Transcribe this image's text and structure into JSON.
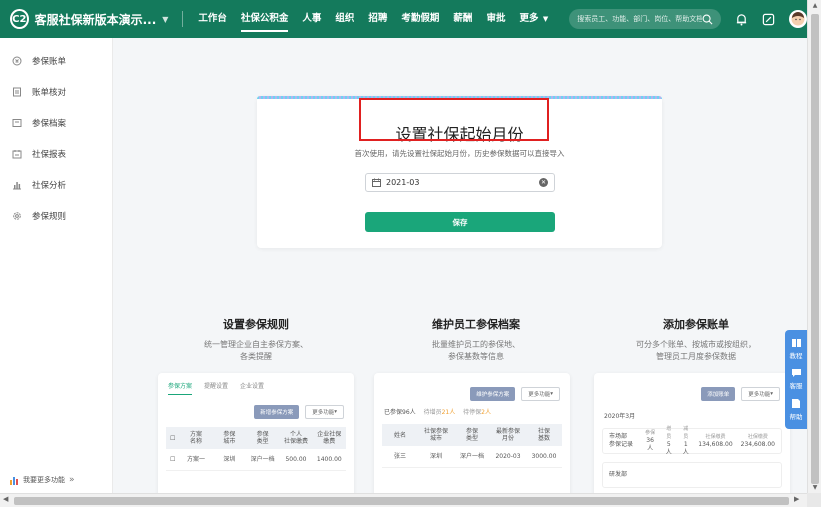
{
  "header": {
    "logo_text": "C2",
    "company_name": "客服社保新版本演示...",
    "nav": [
      {
        "label": "工作台",
        "active": false
      },
      {
        "label": "社保公积金",
        "active": true
      },
      {
        "label": "人事",
        "active": false
      },
      {
        "label": "组织",
        "active": false
      },
      {
        "label": "招聘",
        "active": false
      },
      {
        "label": "考勤假期",
        "active": false
      },
      {
        "label": "薪酬",
        "active": false
      },
      {
        "label": "审批",
        "active": false
      },
      {
        "label": "更多",
        "active": false
      }
    ],
    "search_placeholder": "搜索员工、功能、部门、岗位、帮助文档"
  },
  "sidebar": {
    "items": [
      {
        "label": "参保账单",
        "icon": "bill-icon"
      },
      {
        "label": "账单核对",
        "icon": "check-doc-icon"
      },
      {
        "label": "参保档案",
        "icon": "archive-icon"
      },
      {
        "label": "社保报表",
        "icon": "report-icon"
      },
      {
        "label": "社保分析",
        "icon": "bar-chart-icon"
      },
      {
        "label": "参保规则",
        "icon": "gear-icon"
      }
    ],
    "footer": "我要更多功能"
  },
  "setup_card": {
    "title": "设置社保起始月份",
    "subtitle": "首次使用，请先设置社保起始月份，历史参保数据可以直接导入",
    "date_value": "2021-03",
    "save_label": "保存"
  },
  "features": [
    {
      "title": "设置参保规则",
      "desc1": "统一管理企业自主参保方案、",
      "desc2": "各类提醒"
    },
    {
      "title": "维护员工参保档案",
      "desc1": "批量维护员工的参保地、",
      "desc2": "参保基数等信息"
    },
    {
      "title": "添加参保账单",
      "desc1": "可分多个账单、按城市或按组织，",
      "desc2": "管理员工月度参保数据"
    }
  ],
  "preview_rules": {
    "tabs": [
      "参保方案",
      "提醒设置",
      "企业设置"
    ],
    "btn_primary": "新增参保方案",
    "btn_more": "更多功能",
    "headers": [
      "方案\n名称",
      "参保\n城市",
      "参保\n类型",
      "个人\n社保缴费",
      "企业社保\n缴费"
    ],
    "row": [
      "方案一",
      "深圳",
      "深户一档",
      "500.00",
      "1400.00"
    ]
  },
  "preview_archive": {
    "btn_primary": "维护参保方案",
    "btn_more": "更多功能",
    "stats_main": "已参保96人",
    "stats_pending_label": "待增员",
    "stats_pending_value": "21人",
    "stats_reduce_label": "待停保",
    "stats_reduce_value": "2人",
    "headers": [
      "姓名",
      "社保参保\n城市",
      "参保\n类型",
      "最新参保\n月份",
      "社保\n基数"
    ],
    "row": [
      "张三",
      "深圳",
      "深户一档",
      "2020-03",
      "3000.00"
    ]
  },
  "preview_bill": {
    "btn_primary": "添加账单",
    "btn_more": "更多功能",
    "month": "2020年3月",
    "dept": "市场部\n参保记录",
    "kvs": [
      {
        "k": "参保",
        "v": "36人"
      },
      {
        "k": "增员",
        "v": "5人"
      },
      {
        "k": "减员",
        "v": "1人"
      },
      {
        "k": "社保缴费",
        "v": "134,608.00"
      },
      {
        "k": "社保缴费",
        "v": "234,608.00"
      }
    ],
    "dept2": "研发部"
  },
  "helpers": [
    {
      "label": "教程",
      "icon": "book-icon"
    },
    {
      "label": "客服",
      "icon": "chat-icon"
    },
    {
      "label": "帮助",
      "icon": "doc-icon"
    }
  ]
}
